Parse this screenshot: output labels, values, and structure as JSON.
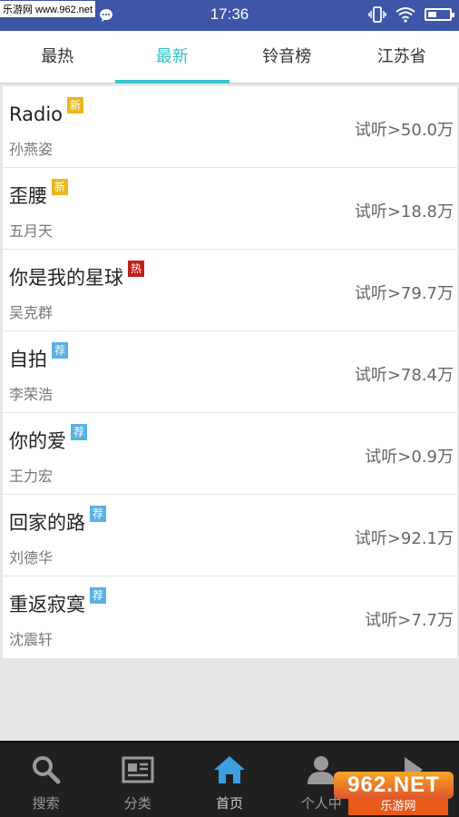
{
  "status_bar": {
    "watermark": "乐游网 www.962.net",
    "time": "17:36",
    "battery_level": 0.4
  },
  "tabs": [
    {
      "label": "最热"
    },
    {
      "label": "最新"
    },
    {
      "label": "铃音榜"
    },
    {
      "label": "江苏省"
    }
  ],
  "active_tab": 1,
  "songs": [
    {
      "title": "Radio",
      "badge": "新",
      "badge_color": "#e9b820",
      "artist": "孙燕姿",
      "plays": "试听>50.0万"
    },
    {
      "title": "歪腰",
      "badge": "新",
      "badge_color": "#e9b820",
      "artist": "五月天",
      "plays": "试听>18.8万"
    },
    {
      "title": "你是我的星球",
      "badge": "热",
      "badge_color": "#c0201b",
      "artist": "吴克群",
      "plays": "试听>79.7万"
    },
    {
      "title": "自拍",
      "badge": "荐",
      "badge_color": "#5ab0e2",
      "artist": "李荣浩",
      "plays": "试听>78.4万"
    },
    {
      "title": "你的爱",
      "badge": "荐",
      "badge_color": "#5ab0e2",
      "artist": "王力宏",
      "plays": "试听>0.9万"
    },
    {
      "title": "回家的路",
      "badge": "荐",
      "badge_color": "#5ab0e2",
      "artist": "刘德华",
      "plays": "试听>92.1万"
    },
    {
      "title": "重返寂寞",
      "badge": "荐",
      "badge_color": "#5ab0e2",
      "artist": "沈震轩",
      "plays": "试听>7.7万"
    }
  ],
  "bottom_nav": [
    {
      "label": "搜索",
      "icon": "search-icon"
    },
    {
      "label": "分类",
      "icon": "newspaper-icon"
    },
    {
      "label": "首页",
      "icon": "home-icon"
    },
    {
      "label": "个人中",
      "icon": "person-icon"
    },
    {
      "label": "",
      "icon": "play-icon"
    }
  ],
  "watermark_logo": {
    "main": "962.NET",
    "sub": "乐游网"
  },
  "colors": {
    "status_bar": "#3d56a8",
    "accent": "#31c2c8",
    "nav_background": "#202020",
    "home_icon": "#3b9fe0"
  }
}
